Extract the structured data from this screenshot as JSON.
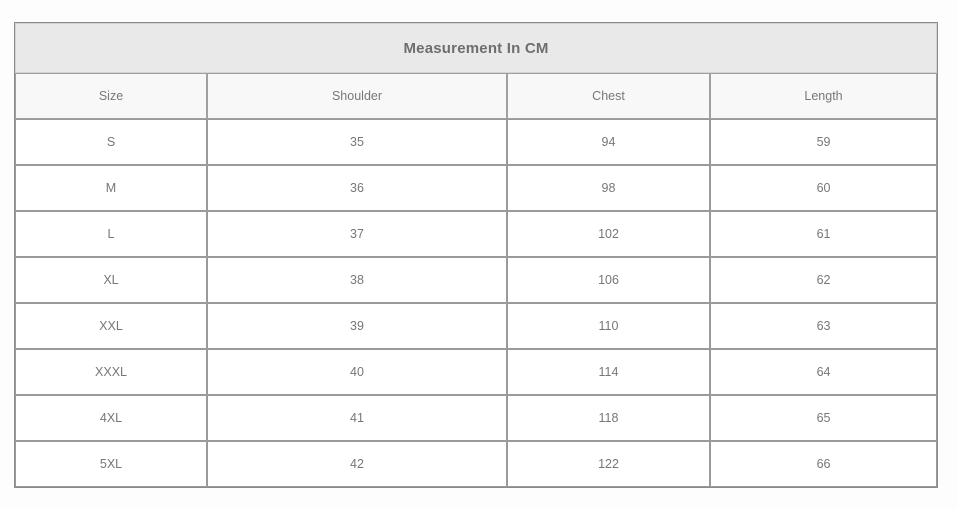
{
  "table": {
    "title": "Measurement In CM",
    "columns": [
      "Size",
      "Shoulder",
      "Chest",
      "Length"
    ],
    "rows": [
      {
        "size": "S",
        "shoulder": "35",
        "chest": "94",
        "length": "59"
      },
      {
        "size": "M",
        "shoulder": "36",
        "chest": "98",
        "length": "60"
      },
      {
        "size": "L",
        "shoulder": "37",
        "chest": "102",
        "length": "61"
      },
      {
        "size": "XL",
        "shoulder": "38",
        "chest": "106",
        "length": "62"
      },
      {
        "size": "XXL",
        "shoulder": "39",
        "chest": "110",
        "length": "63"
      },
      {
        "size": "XXXL",
        "shoulder": "40",
        "chest": "114",
        "length": "64"
      },
      {
        "size": "4XL",
        "shoulder": "41",
        "chest": "118",
        "length": "65"
      },
      {
        "size": "5XL",
        "shoulder": "42",
        "chest": "122",
        "length": "66"
      }
    ]
  },
  "colors": {
    "title_background": "#e9e9e9",
    "header_background": "#f8f8f8",
    "cell_background": "#ffffff",
    "text": "#777777",
    "title_text": "#6e6e6e",
    "border": "#9a9a9a",
    "page_background": "#fdfdfd"
  }
}
